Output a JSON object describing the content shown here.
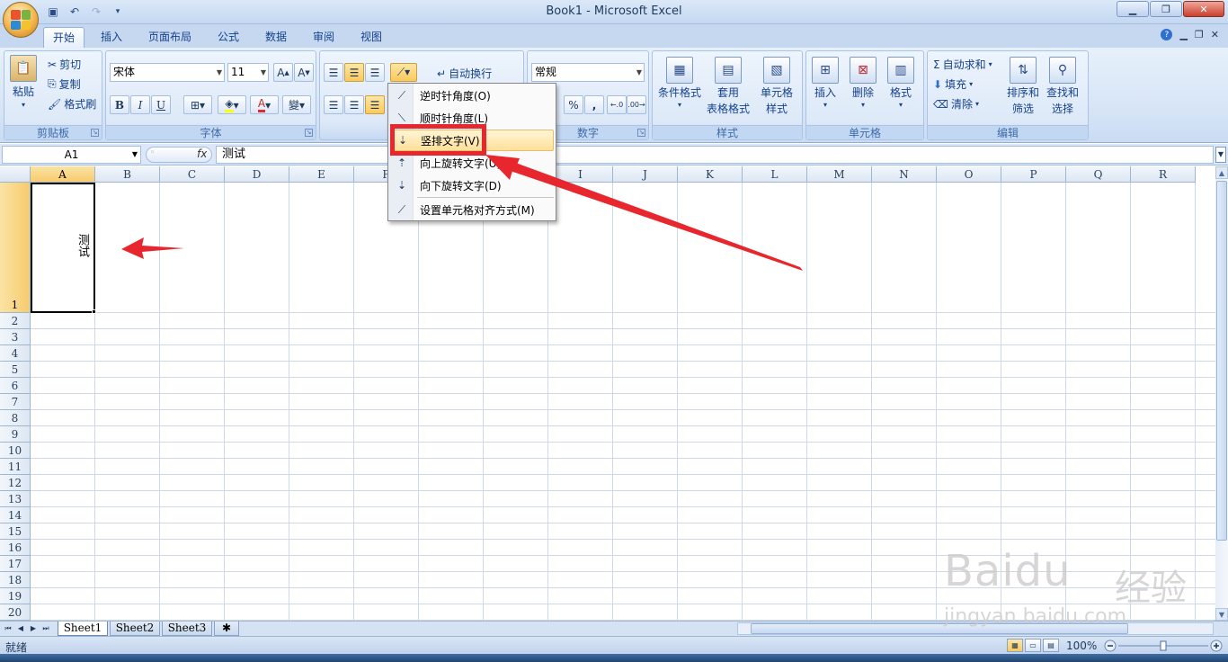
{
  "window": {
    "title": "Book1 - Microsoft Excel"
  },
  "tabs": [
    "开始",
    "插入",
    "页面布局",
    "公式",
    "数据",
    "审阅",
    "视图"
  ],
  "clipboard": {
    "paste": "粘贴",
    "cut": "剪切",
    "copy": "复制",
    "format_painter": "格式刷",
    "label": "剪贴板"
  },
  "font": {
    "name": "宋体",
    "size": "11",
    "label": "字体",
    "bold": "B",
    "italic": "I",
    "underline": "U"
  },
  "alignment": {
    "wrap_text": "自动换行"
  },
  "number": {
    "format": "常规",
    "percent": "%",
    "comma": ",",
    "label": "数字"
  },
  "styles": {
    "conditional_format": "条件格式",
    "table_format_1": "套用",
    "table_format_2": "表格格式",
    "cell_styles_1": "单元格",
    "cell_styles_2": "样式",
    "label": "样式"
  },
  "cells": {
    "insert": "插入",
    "delete": "删除",
    "format": "格式",
    "label": "单元格"
  },
  "editing": {
    "autosum": "自动求和",
    "fill": "填充",
    "clear": "清除",
    "sort_1": "排序和",
    "sort_2": "筛选",
    "find_1": "查找和",
    "find_2": "选择",
    "label": "编辑"
  },
  "formula_bar": {
    "name_box": "A1",
    "fx": "fx",
    "content": "测试"
  },
  "columns": [
    "A",
    "B",
    "C",
    "D",
    "E",
    "F",
    "G",
    "H",
    "I",
    "J",
    "K",
    "L",
    "M",
    "N",
    "O",
    "P",
    "Q",
    "R"
  ],
  "rows": [
    "1",
    "2",
    "3",
    "4",
    "5",
    "6",
    "7",
    "8",
    "9",
    "10",
    "11",
    "12",
    "13",
    "14",
    "15",
    "16",
    "17",
    "18",
    "19",
    "20"
  ],
  "cell_a1": "测试",
  "orientation_menu": {
    "items": [
      {
        "label": "逆时针角度(O)",
        "icon": "ccw-angle-icon"
      },
      {
        "label": "顺时针角度(L)",
        "icon": "cw-angle-icon"
      },
      {
        "label": "竖排文字(V)",
        "icon": "vertical-text-icon",
        "highlighted": true
      },
      {
        "label": "向上旋转文字(U)",
        "icon": "rotate-up-icon"
      },
      {
        "label": "向下旋转文字(D)",
        "icon": "rotate-down-icon"
      },
      {
        "label": "设置单元格对齐方式(M)",
        "icon": "format-alignment-icon"
      }
    ]
  },
  "sheets": [
    "Sheet1",
    "Sheet2",
    "Sheet3"
  ],
  "status": {
    "ready": "就绪",
    "zoom": "100%"
  },
  "watermark": {
    "logo": "Baidu",
    "jingyan": "经验",
    "url": "jingyan.baidu.com"
  },
  "colors": {
    "annotation_red": "#e8262e",
    "selection_header": "#f8cb6e",
    "ribbon_bg": "#d5e4f6"
  }
}
